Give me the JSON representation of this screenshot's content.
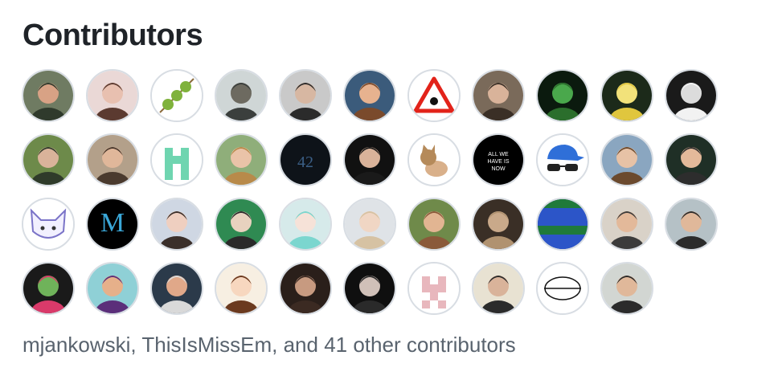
{
  "heading": "Contributors",
  "avatars": [
    {
      "bg": "#6f7b62",
      "fg": "#2f3a2c",
      "skin": "#d8a285",
      "label": ""
    },
    {
      "bg": "#ead8d6",
      "fg": "#5b3a30",
      "skin": "#e8c0b0",
      "label": ""
    },
    {
      "bg": "#ffffff",
      "fg": "#7fb23c",
      "skin": "#7fb23c",
      "label": "",
      "kind": "skewer"
    },
    {
      "bg": "#cfd6d6",
      "fg": "#3b3f3d",
      "skin": "#6d6a60",
      "label": ""
    },
    {
      "bg": "#c9c9c9",
      "fg": "#2b2b2b",
      "skin": "#d7b7a2",
      "label": ""
    },
    {
      "bg": "#3b5b7b",
      "fg": "#7a4a2c",
      "skin": "#e7b28f",
      "label": ""
    },
    {
      "bg": "#ffffff",
      "fg": "#e2231a",
      "skin": "#e2231a",
      "label": "",
      "kind": "triangle"
    },
    {
      "bg": "#7a6a5a",
      "fg": "#3a2f26",
      "skin": "#d9b39a",
      "label": ""
    },
    {
      "bg": "#0b1a0e",
      "fg": "#2b6e2c",
      "skin": "#4aa84c",
      "label": ""
    },
    {
      "bg": "#1c2a1a",
      "fg": "#e0c63e",
      "skin": "#f2e27a",
      "label": ""
    },
    {
      "bg": "#1a1a1a",
      "fg": "#f2f2f2",
      "skin": "#dcdcdc",
      "label": ""
    },
    {
      "bg": "#6d8a4a",
      "fg": "#2f3b2a",
      "skin": "#d9b39a",
      "label": ""
    },
    {
      "bg": "#b3a08a",
      "fg": "#4a3a2e",
      "skin": "#e0b79a",
      "label": ""
    },
    {
      "bg": "#ffffff",
      "fg": "#6fd5b0",
      "skin": "#6fd5b0",
      "label": "",
      "kind": "identicon"
    },
    {
      "bg": "#8fae7a",
      "fg": "#b88a4a",
      "skin": "#eac3a8",
      "label": ""
    },
    {
      "bg": "#0e1319",
      "fg": "#3b5f86",
      "skin": "#3b5f86",
      "label": "42",
      "kind": "text"
    },
    {
      "bg": "#111111",
      "fg": "#1a1a1a",
      "skin": "#d9b39a",
      "label": ""
    },
    {
      "bg": "#ffffff",
      "fg": "#b58a5a",
      "skin": "#d9b08a",
      "label": "",
      "kind": "cat"
    },
    {
      "bg": "#000000",
      "fg": "#ffffff",
      "skin": "#ffffff",
      "label": "ALL WE HAVE IS NOW",
      "kind": "text"
    },
    {
      "bg": "#ffffff",
      "fg": "#2f6fd8",
      "skin": "#222222",
      "label": "",
      "kind": "cap"
    },
    {
      "bg": "#8aa6c0",
      "fg": "#6b4a2e",
      "skin": "#e7c2a6",
      "label": ""
    },
    {
      "bg": "#1f2f26",
      "fg": "#2d2d2d",
      "skin": "#e3b99a",
      "label": ""
    },
    {
      "bg": "#ffffff",
      "fg": "#7b74c8",
      "skin": "#f2f0ff",
      "label": "",
      "kind": "fox"
    },
    {
      "bg": "#000000",
      "fg": "#3aa7d8",
      "skin": "#3aa7d8",
      "label": "M",
      "kind": "text"
    },
    {
      "bg": "#cfd7e3",
      "fg": "#3a2f2a",
      "skin": "#efcfc0",
      "label": ""
    },
    {
      "bg": "#2f8a52",
      "fg": "#2a2a2a",
      "skin": "#e8d2bf",
      "label": ""
    },
    {
      "bg": "#d6eaea",
      "fg": "#7bd6cf",
      "skin": "#f6e2d8",
      "label": ""
    },
    {
      "bg": "#dfe3e7",
      "fg": "#d6c2a3",
      "skin": "#f0d6c4",
      "label": ""
    },
    {
      "bg": "#6f8a4a",
      "fg": "#8a5a3a",
      "skin": "#e2b592",
      "label": ""
    },
    {
      "bg": "#3a2f26",
      "fg": "#b09270",
      "skin": "#c9a98a",
      "label": ""
    },
    {
      "bg": "#1f3fa6",
      "fg": "#1f7a3a",
      "skin": "#2c55c8",
      "label": "",
      "kind": "pixels"
    },
    {
      "bg": "#d9d2c8",
      "fg": "#3b3b3b",
      "skin": "#e3b99a",
      "label": ""
    },
    {
      "bg": "#b5c1c6",
      "fg": "#2b2b2b",
      "skin": "#e0b89a",
      "label": ""
    },
    {
      "bg": "#1a1a1a",
      "fg": "#d93a6a",
      "skin": "#6fb35a",
      "label": ""
    },
    {
      "bg": "#8fd0d6",
      "fg": "#5b2f7a",
      "skin": "#e6b08a",
      "label": ""
    },
    {
      "bg": "#2b3a4a",
      "fg": "#d9d9d9",
      "skin": "#e0a889",
      "label": ""
    },
    {
      "bg": "#f7efe2",
      "fg": "#6b3a1f",
      "skin": "#f7d7bf",
      "label": ""
    },
    {
      "bg": "#2a1f1a",
      "fg": "#3b2a22",
      "skin": "#c79a80",
      "label": ""
    },
    {
      "bg": "#0f0f0f",
      "fg": "#2a2a2a",
      "skin": "#d0c0b8",
      "label": ""
    },
    {
      "bg": "#ffffff",
      "fg": "#e8b7bd",
      "skin": "#e8b7bd",
      "label": "",
      "kind": "identicon2"
    },
    {
      "bg": "#e8e2d2",
      "fg": "#2b2b2b",
      "skin": "#d9b39a",
      "label": ""
    },
    {
      "bg": "#ffffff",
      "fg": "#111111",
      "skin": "#111111",
      "label": "",
      "kind": "stamp"
    },
    {
      "bg": "#d2d6d2",
      "fg": "#2b2b2b",
      "skin": "#e0b89a",
      "label": ""
    }
  ],
  "summary": {
    "user1": "mjankowski",
    "sep1": ", ",
    "user2": "ThisIsMissEm",
    "sep2": ", and ",
    "others": "41 other contributors"
  }
}
